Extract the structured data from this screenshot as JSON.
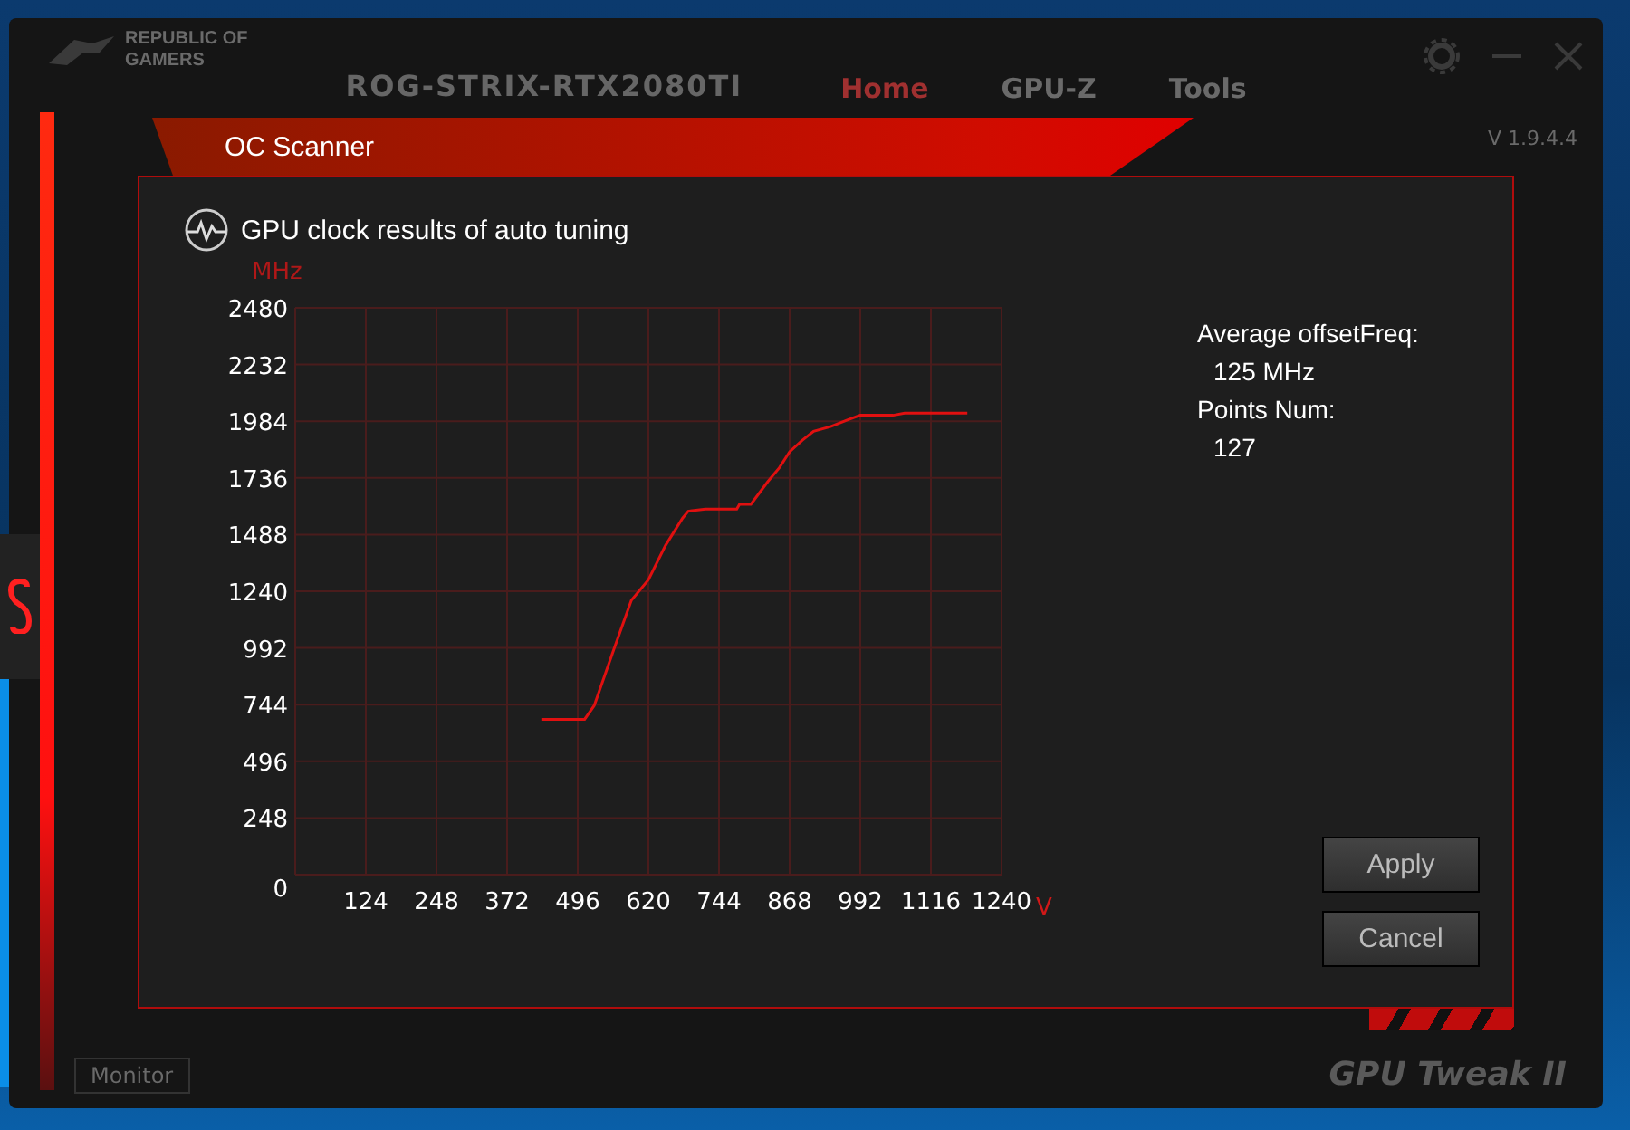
{
  "background_app": {
    "logo_lines": [
      "REPUBLIC OF",
      "GAMERS"
    ],
    "device": "ROG-STRIX-RTX2080TI",
    "tabs": [
      {
        "label": "Home",
        "selected": true
      },
      {
        "label": "GPU-Z",
        "selected": false
      },
      {
        "label": "Tools",
        "selected": false
      }
    ],
    "version": "V 1.9.4.4",
    "footer_button": "Monitor",
    "brand": "GPU Tweak II"
  },
  "dialog": {
    "title": "OC Scanner",
    "chart_title": "GPU clock results of auto tuning",
    "chart_data": {
      "type": "line",
      "ylabel": "MHz",
      "xlabel": "V",
      "xlim": [
        0,
        1240
      ],
      "ylim": [
        0,
        2480
      ],
      "xticks": [
        124,
        248,
        372,
        496,
        620,
        744,
        868,
        992,
        1116,
        1240
      ],
      "yticks": [
        0,
        248,
        496,
        744,
        992,
        1240,
        1488,
        1736,
        1984,
        2232,
        2480
      ],
      "x": [
        432,
        508,
        525,
        560,
        590,
        620,
        650,
        680,
        690,
        720,
        775,
        780,
        800,
        830,
        850,
        868,
        890,
        910,
        940,
        970,
        992,
        1050,
        1070,
        1180
      ],
      "grid": true,
      "series": [
        {
          "color": "#e01010",
          "values": [
            680,
            680,
            740,
            990,
            1200,
            1290,
            1440,
            1560,
            1590,
            1600,
            1600,
            1620,
            1620,
            1720,
            1780,
            1850,
            1900,
            1940,
            1960,
            1990,
            2010,
            2010,
            2020,
            2020
          ]
        }
      ]
    },
    "stats": [
      {
        "label": "Average offsetFreq:",
        "value": "125 MHz"
      },
      {
        "label": "Points Num:",
        "value": "127"
      }
    ],
    "buttons": [
      "Apply",
      "Cancel"
    ]
  }
}
